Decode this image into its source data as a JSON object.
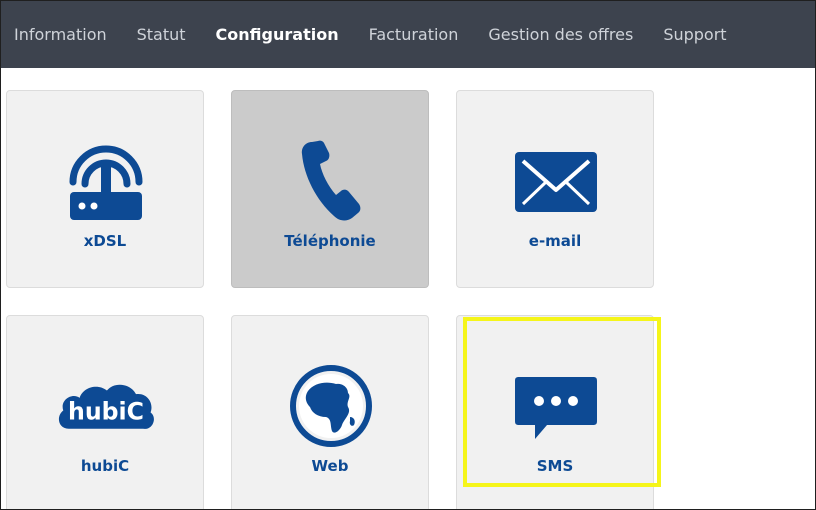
{
  "nav": {
    "items": [
      {
        "label": "Information"
      },
      {
        "label": "Statut"
      },
      {
        "label": "Configuration",
        "active": true
      },
      {
        "label": "Facturation"
      },
      {
        "label": "Gestion des offres"
      },
      {
        "label": "Support"
      }
    ]
  },
  "tiles": [
    {
      "label": "xDSL",
      "icon": "router-icon"
    },
    {
      "label": "Téléphonie",
      "icon": "phone-icon",
      "selected": true
    },
    {
      "label": "e-mail",
      "icon": "envelope-icon"
    },
    {
      "label": "hubiC",
      "icon": "hubic-logo",
      "logo_text": "hubiC"
    },
    {
      "label": "Web",
      "icon": "globe-icon"
    },
    {
      "label": "SMS",
      "icon": "sms-bubble-icon"
    }
  ],
  "colors": {
    "nav_bg": "#3d434e",
    "icon_blue": "#0d4a94",
    "tile_bg": "#f1f1f1",
    "tile_selected_bg": "#cbcbcb",
    "highlight": "#f5f51a"
  }
}
